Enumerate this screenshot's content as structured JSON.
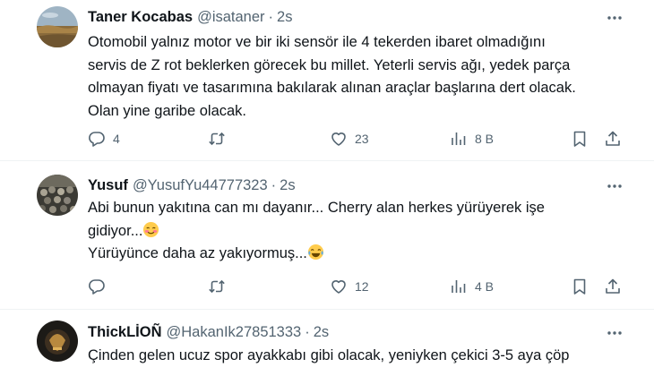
{
  "tweets": [
    {
      "name": "Taner Kocabas",
      "handle": "@isataner",
      "separator": "·",
      "time": "2s",
      "lines": [
        "Otomobil yalnız motor ve bir iki sensör ile 4 tekerden ibaret olmadığını",
        "servis de  Z rot beklerken görecek bu millet. Yeterli servis ağı, yedek parça",
        "olmayan fiyatı ve tasarımına bakılarak alınan araçlar başlarına dert olacak.",
        "Olan yine garibe olacak."
      ],
      "replies": "4",
      "retweets": "",
      "likes": "23",
      "views": "8 B"
    },
    {
      "name": "Yusuf",
      "handle": "@YusufYu44777323",
      "separator": "·",
      "time": "2s",
      "lines": [
        "Abi bunun yakıtına can mı dayanır... Cherry alan herkes yürüyerek işe",
        "gidiyor...",
        "Yürüyünce daha az yakıyormuş..."
      ],
      "replies": "",
      "retweets": "",
      "likes": "12",
      "views": "4 B"
    },
    {
      "name": "ThickLİOÑ",
      "handle": "@HakanIk27851333",
      "separator": "·",
      "time": "2s",
      "lines": [
        "Çinden gelen ucuz spor ayakkabı gibi olacak, yeniyken çekici 3-5 aya çöp"
      ]
    }
  ],
  "icons": {
    "more": "more-horizontal-icon",
    "reply": "reply-icon",
    "retweet": "retweet-icon",
    "like": "heart-icon",
    "views": "views-chart-icon",
    "bookmark": "bookmark-icon",
    "share": "share-icon",
    "blush_emoji": "blushing-face-emoji",
    "laugh_emoji": "tears-of-joy-emoji"
  },
  "colors": {
    "text": "#0f1419",
    "secondary": "#536471",
    "divider": "#eff3f4"
  }
}
